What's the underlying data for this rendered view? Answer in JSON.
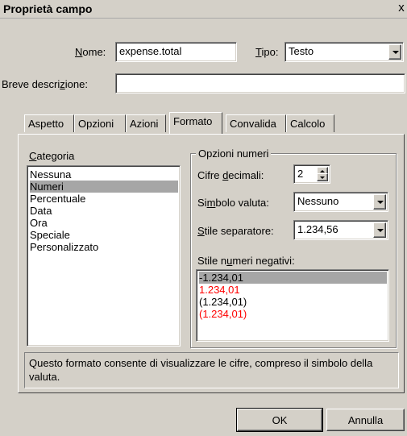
{
  "window": {
    "title": "Proprietà campo",
    "close_glyph": "x"
  },
  "header": {
    "name_label": "Nome:",
    "name_value": "expense.total",
    "type_label": "Tipo:",
    "type_value": "Testo",
    "desc_label": "Breve descrizione:",
    "desc_value": ""
  },
  "tabs": [
    {
      "label": "Aspetto"
    },
    {
      "label": "Opzioni"
    },
    {
      "label": "Azioni"
    },
    {
      "label": "Formato",
      "active": true
    },
    {
      "label": "Convalida"
    },
    {
      "label": "Calcolo"
    }
  ],
  "category": {
    "label": "Categoria",
    "items": [
      "Nessuna",
      "Numeri",
      "Percentuale",
      "Data",
      "Ora",
      "Speciale",
      "Personalizzato"
    ],
    "selected": "Numeri"
  },
  "number_options": {
    "group_label": "Opzioni numeri",
    "decimals_label": "Cifre decimali:",
    "decimals_value": "2",
    "currency_label": "Simbolo valuta:",
    "currency_value": "Nessuno",
    "separator_label": "Stile separatore:",
    "separator_value": "1.234,56",
    "negative_label": "Stile numeri negativi:",
    "negative_items": [
      {
        "text": "-1.234,01",
        "color": "#000000",
        "selected": true
      },
      {
        "text": "1.234,01",
        "color": "#ff0000"
      },
      {
        "text": "(1.234,01)",
        "color": "#000000"
      },
      {
        "text": "(1.234,01)",
        "color": "#ff0000"
      }
    ]
  },
  "description": {
    "line1": "Questo formato consente di visualizzare le cifre, compreso il simbolo della",
    "line2": "valuta."
  },
  "buttons": {
    "ok": "OK",
    "cancel": "Annulla"
  }
}
